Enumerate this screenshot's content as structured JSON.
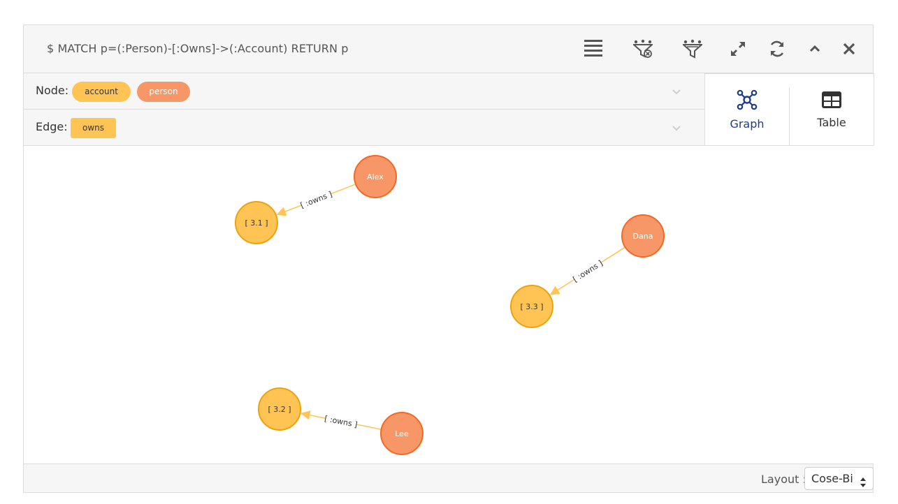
{
  "query": "$ MATCH p=(:Person)-[:Owns]->(:Account) RETURN p",
  "toolbar": {
    "icons": [
      "list-icon",
      "filter-remove-icon",
      "filter-icon",
      "expand-icon",
      "refresh-icon",
      "chevron-up-icon",
      "close-icon"
    ]
  },
  "filters": {
    "node_label": "Node:",
    "node_tags": [
      {
        "name": "account",
        "color": "#ffc454"
      },
      {
        "name": "person",
        "color": "#f79767"
      }
    ],
    "edge_label": "Edge:",
    "edge_tags": [
      {
        "name": "owns",
        "color": "#ffc454"
      }
    ]
  },
  "view": {
    "graph_label": "Graph",
    "table_label": "Table",
    "active": "Graph"
  },
  "graph": {
    "nodes": [
      {
        "id": "alex",
        "label": "Alex",
        "type": "person"
      },
      {
        "id": "a31",
        "label": "[ 3.1 ]",
        "type": "account"
      },
      {
        "id": "dana",
        "label": "Dana",
        "type": "person"
      },
      {
        "id": "a33",
        "label": "[ 3.3 ]",
        "type": "account"
      },
      {
        "id": "a32",
        "label": "[ 3.2 ]",
        "type": "account"
      },
      {
        "id": "lee",
        "label": "Lee",
        "type": "person"
      }
    ],
    "edges": [
      {
        "from": "alex",
        "to": "a31",
        "label": "[ :owns ]"
      },
      {
        "from": "dana",
        "to": "a33",
        "label": "[ :owns ]"
      },
      {
        "from": "lee",
        "to": "a32",
        "label": "[ :owns ]"
      }
    ],
    "colors": {
      "person_fill": "#f79767",
      "person_stroke": "#f36924",
      "account_fill": "#ffc454",
      "account_stroke": "#eda20c",
      "edge": "#ffc454",
      "accent": "#1f3c88"
    }
  },
  "footer": {
    "layout_label": "Layout :",
    "layout_value": "Cose-Bi"
  }
}
